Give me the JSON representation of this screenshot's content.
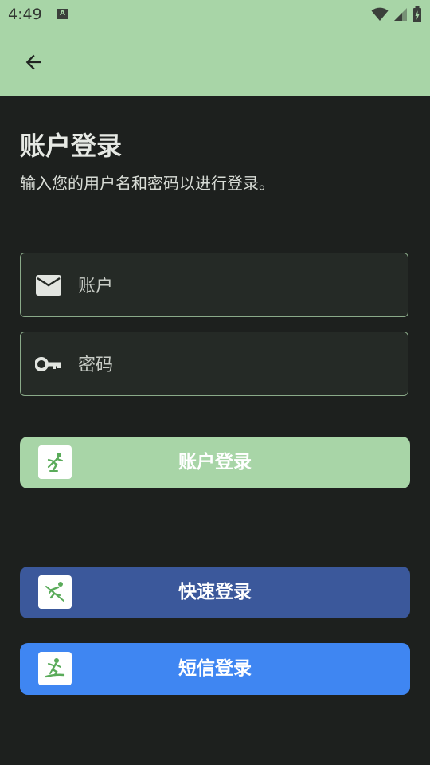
{
  "status_bar": {
    "time": "4:49",
    "notification_badge": "A"
  },
  "header": {
    "title": "账户登录",
    "subtitle": "输入您的用户名和密码以进行登录。"
  },
  "form": {
    "account": {
      "placeholder": "账户",
      "value": ""
    },
    "password": {
      "placeholder": "密码",
      "value": ""
    }
  },
  "buttons": {
    "account_login": {
      "label": "账户登录",
      "color": "#a8d5a7",
      "icon": "ice-skater-icon"
    },
    "quick_login": {
      "label": "快速登录",
      "color": "#3b589b",
      "icon": "skier-icon"
    },
    "sms_login": {
      "label": "短信登录",
      "color": "#3f86f2",
      "icon": "snowboarder-icon"
    }
  },
  "colors": {
    "app_bar": "#a8d5a7",
    "background": "#1d201e",
    "field_border": "#8aaa89",
    "icon_green": "#5aab5a"
  }
}
